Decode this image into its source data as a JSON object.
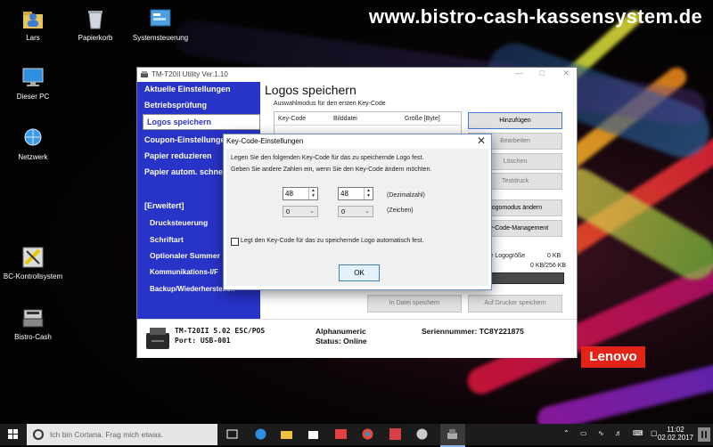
{
  "watermark": "www.bistro-cash-kassensystem.de",
  "brand": "Lenovo",
  "desktop_icons": [
    {
      "label": "Lars",
      "icon": "user-folder-icon"
    },
    {
      "label": "Papierkorb",
      "icon": "recycle-bin-icon"
    },
    {
      "label": "Systemsteuerung",
      "icon": "control-panel-icon"
    },
    {
      "label": "Dieser PC",
      "icon": "computer-icon"
    },
    {
      "label": "Netzwerk",
      "icon": "network-icon"
    },
    {
      "label": "BC-Kontrollsystem",
      "icon": "bc-control-icon"
    },
    {
      "label": "Bistro-Cash",
      "icon": "cash-register-icon"
    }
  ],
  "window": {
    "title": "TM-T20II Utility Ver.1.10",
    "sidebar": [
      "Aktuelle Einstellungen",
      "Betriebsprüfung",
      "Logos speichern",
      "Coupon-Einstellungen",
      "Papier reduzieren",
      "Papier autom. schneiden",
      "[Erweitert]",
      "Drucksteuerung",
      "Schriftart",
      "Optionaler Summer",
      "Kommunikations-I/F",
      "Backup/Wiederherstellen"
    ],
    "page_title": "Logos speichern",
    "selection_mode": "Auswahlmodus für den ersten Key-Code",
    "table_headers": [
      "Key-Code",
      "Bilddatei",
      "Größe [Byte]"
    ],
    "buttons": {
      "add": "Hinzufügen",
      "edit": "Bearbeiten",
      "delete": "Löschen",
      "test_print": "Testdruck",
      "logo_mode": "Logomodus ändern",
      "keycode_mgmt": "Key-Code-Management",
      "save_file": "In Datei speichern",
      "save_printer": "Auf Drucker speichern"
    },
    "logo_size_label": "liche Logogröße",
    "logo_size_value": "0 KB",
    "capacity_label": "zt",
    "capacity_value": "0 KB/256 KB",
    "printer": {
      "model": "TM-T20II 5.02 ESC/POS",
      "port": "Port: USB-001",
      "mode": "Alphanumeric",
      "status": "Status: Online",
      "serial": "Seriennummer: TC8Y221875"
    }
  },
  "dialog": {
    "title": "Key-Code-Einstellungen",
    "line1": "Legen Sie den folgenden Key-Code für das zu speichernde Logo fest.",
    "line2": "Geben Sie andere Zahlen ein, wenn Sie den Key-Code ändern möchten.",
    "spin1": "48",
    "spin2": "48",
    "decimal_label": "(Dezimalzahl)",
    "combo1": "0",
    "combo2": "0",
    "char_label": "(Zeichen)",
    "auto_checkbox": "Legt den Key-Code für das zu speichernde Logo automatisch fest.",
    "ok": "OK",
    "close": "✕"
  },
  "taskbar": {
    "search_placeholder": "Ich bin Cortana. Frag mich etwas.",
    "time": "11:02",
    "date": "02.02.2017"
  },
  "colors": {
    "sidebar_blue": "#2833c8",
    "lenovo_red": "#e2231a"
  }
}
